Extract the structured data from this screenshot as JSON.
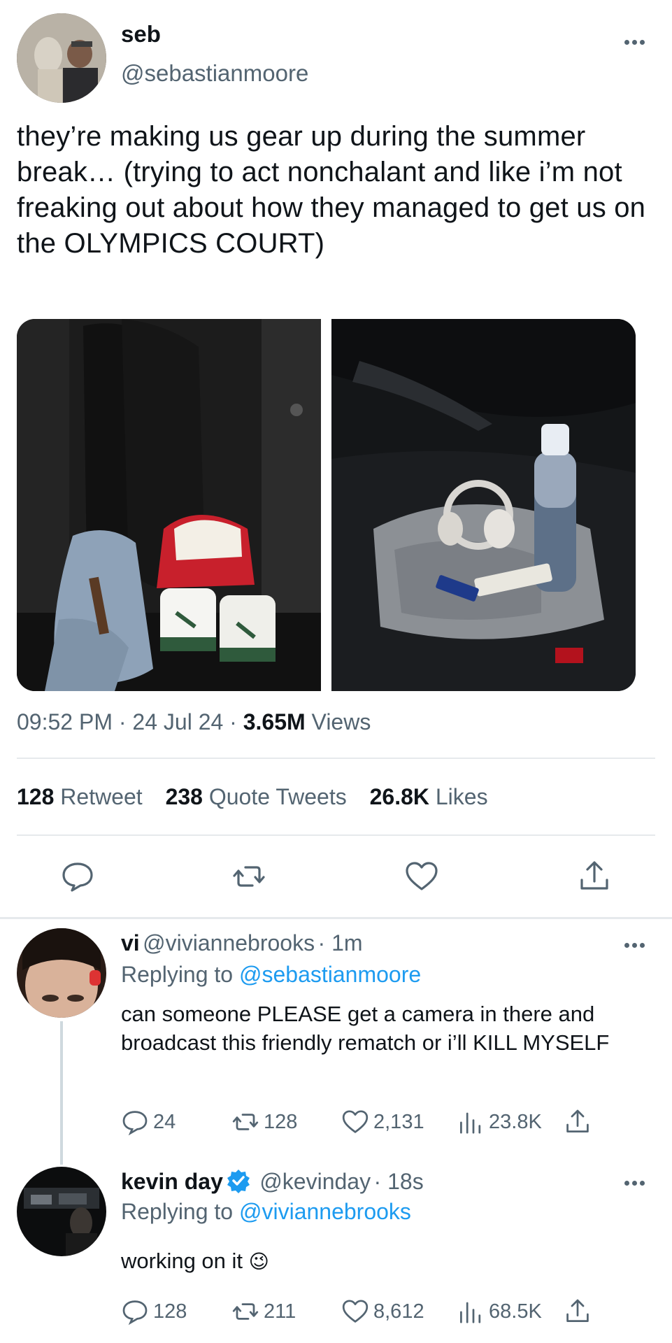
{
  "tweet": {
    "author": {
      "name": "seb",
      "handle": "@sebastianmoore"
    },
    "text": "they’re making us gear up during the summer break… (trying to act nonchalant and like i’m not freaking out about how they managed to get us on the OLYMPICS COURT)",
    "time": "09:52 PM",
    "date": "24 Jul 24",
    "views_count": "3.65M",
    "views_label": "Views",
    "separator": "·",
    "stats": {
      "retweets": {
        "count": "128",
        "label": "Retweet"
      },
      "quotes": {
        "count": "238",
        "label": "Quote Tweets"
      },
      "likes": {
        "count": "26.8K",
        "label": "Likes"
      }
    },
    "actions": [
      "reply-icon",
      "retweet-icon",
      "heart-icon",
      "share-icon"
    ]
  },
  "replies": [
    {
      "name": "vi",
      "handle": "@viviannebrooks",
      "time": "· 1m",
      "replying_label": "Replying to",
      "replying_to": "@sebastianmoore",
      "text": "can someone PLEASE get a camera in there and broadcast this friendly rematch or i’ll KILL MYSELF",
      "counts": {
        "replies": "24",
        "retweets": "128",
        "likes": "2,131",
        "views": "23.8K"
      }
    },
    {
      "name": "kevin day",
      "handle": "@kevinday",
      "time": "· 18s",
      "verified": true,
      "replying_label": "Replying to",
      "replying_to": "@viviannebrooks",
      "text": "working on it",
      "emoji": "😉",
      "counts": {
        "replies": "128",
        "retweets": "211",
        "likes": "8,612",
        "views": "68.5K"
      }
    }
  ],
  "colors": {
    "text": "#0f1419",
    "secondary": "#536471",
    "link": "#1d9bf0",
    "divider": "#e6e9ec",
    "verified": "#1d9bf0"
  }
}
